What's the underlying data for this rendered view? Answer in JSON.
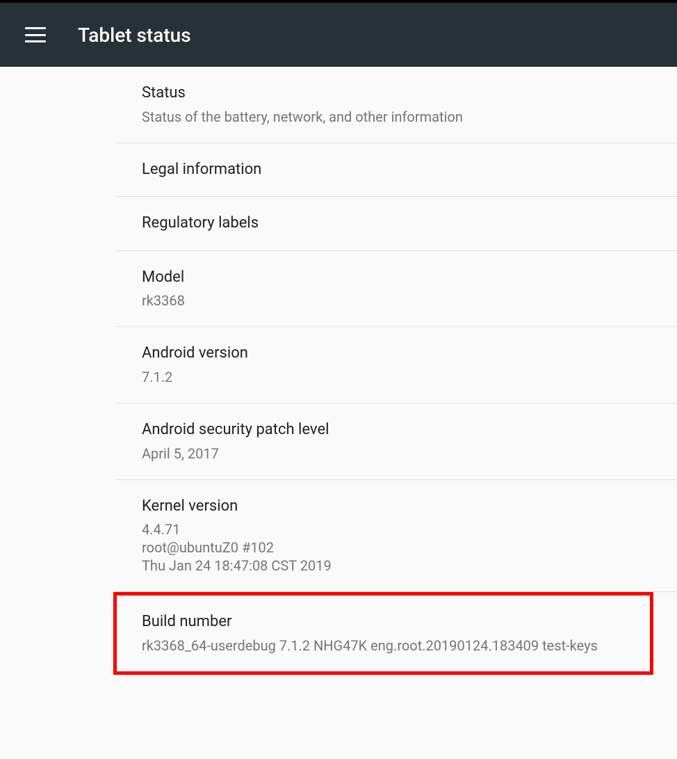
{
  "header": {
    "title": "Tablet status"
  },
  "items": [
    {
      "title": "Status",
      "subtitle": "Status of the battery, network, and other information"
    },
    {
      "title": "Legal information",
      "subtitle": null
    },
    {
      "title": "Regulatory labels",
      "subtitle": null
    },
    {
      "title": "Model",
      "subtitle": "rk3368"
    },
    {
      "title": "Android version",
      "subtitle": "7.1.2"
    },
    {
      "title": "Android security patch level",
      "subtitle": "April 5, 2017"
    },
    {
      "title": "Kernel version",
      "subtitle": "4.4.71\nroot@ubuntuZ0 #102\nThu Jan 24 18:47:08 CST 2019"
    },
    {
      "title": "Build number",
      "subtitle": "rk3368_64-userdebug 7.1.2 NHG47K eng.root.20190124.183409 test-keys"
    }
  ]
}
